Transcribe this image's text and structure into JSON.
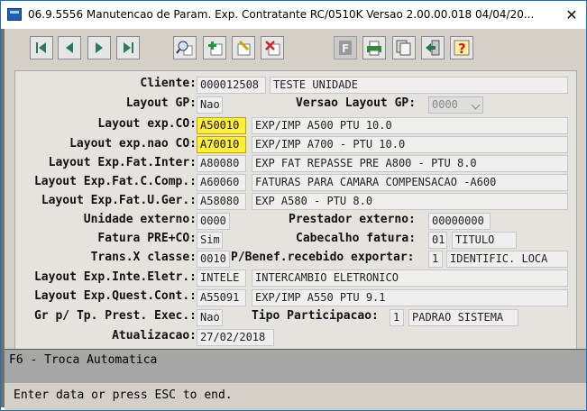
{
  "window": {
    "title": "06.9.5556 Manutencao  de Param. Exp. Contratante RC/0510K Versao 2.00.00.018 04/04/20...",
    "close": "✕"
  },
  "toolbar": {
    "buttons": [
      {
        "name": "first-record-button",
        "icon": "first-icon"
      },
      {
        "name": "previous-record-button",
        "icon": "previous-icon"
      },
      {
        "name": "next-record-button",
        "icon": "next-icon"
      },
      {
        "name": "last-record-button",
        "icon": "last-icon"
      },
      {
        "name": "search-button",
        "icon": "search-icon"
      },
      {
        "name": "add-button",
        "icon": "add-icon"
      },
      {
        "name": "edit-button",
        "icon": "edit-icon"
      },
      {
        "name": "delete-button",
        "icon": "delete-icon"
      },
      {
        "name": "format-button",
        "icon": "format-icon"
      },
      {
        "name": "print-button",
        "icon": "print-icon"
      },
      {
        "name": "copy-button",
        "icon": "copy-icon"
      },
      {
        "name": "exit-button",
        "icon": "exit-icon"
      },
      {
        "name": "help-button",
        "icon": "help-icon"
      }
    ]
  },
  "form": {
    "cliente": {
      "label": "Cliente:",
      "code": "000012508",
      "desc": "TESTE UNIDADE"
    },
    "layout_gp": {
      "label": "Layout GP:",
      "value": "Nao"
    },
    "versao_layout_gp": {
      "label": "Versao Layout GP:",
      "value": "0000"
    },
    "layout_exp_co": {
      "label": "Layout exp.CO:",
      "code": "A50010",
      "desc": "EXP/IMP A500 PTU 10.0"
    },
    "layout_exp_nao_co": {
      "label": "Layout exp.nao CO:",
      "code": "A70010",
      "desc": "EXP/IMP A700 - PTU 10.0"
    },
    "layout_exp_fat_inter": {
      "label": "Layout Exp.Fat.Inter:",
      "code": "A80080",
      "desc": "EXP FAT REPASSE PRE A800 - PTU 8.0"
    },
    "layout_exp_fat_c_comp": {
      "label": "Layout Exp.Fat.C.Comp.:",
      "code": "A60060",
      "desc": "FATURAS PARA CAMARA COMPENSACAO -A600"
    },
    "layout_exp_fat_u_ger": {
      "label": "Layout Exp.Fat.U.Ger.:",
      "code": "A58080",
      "desc": "EXP A580 - PTU 8.0"
    },
    "unidade_externo": {
      "label": "Unidade externo:",
      "value": "0000"
    },
    "prestador_externo": {
      "label": "Prestador externo:",
      "value": "00000000"
    },
    "fatura_pre_co": {
      "label": "Fatura PRE+CO:",
      "value": "Sim"
    },
    "cabecalho_fatura": {
      "label": "Cabecalho fatura:",
      "code": "01",
      "desc": "TITULO"
    },
    "trans_x_classe": {
      "label": "Trans.X classe:",
      "value": "0010"
    },
    "p_benef": {
      "label": "P/Benef.recebido exportar:",
      "code": "1",
      "desc": "IDENTIFIC. LOCA"
    },
    "layout_exp_inte_eletr": {
      "label": "Layout Exp.Inte.Eletr.:",
      "code": "INTELE",
      "desc": "INTERCAMBIO ELETRONICO"
    },
    "layout_exp_quest_cont": {
      "label": "Layout Exp.Quest.Cont.:",
      "code": "A55091",
      "desc": "EXP/IMP A550 PTU 9.1"
    },
    "gr_tp_prest_exec": {
      "label": "Gr p/ Tp. Prest. Exec.:",
      "value": "Nao"
    },
    "tipo_participacao": {
      "label": "Tipo Participacao:",
      "code": "1",
      "desc": "PADRAO SISTEMA"
    },
    "atualizacao": {
      "label": "Atualizacao:",
      "value": "27/02/2018"
    }
  },
  "status": {
    "hint": "F6 - Troca Automatica",
    "message": "Enter data or press ESC to end."
  }
}
